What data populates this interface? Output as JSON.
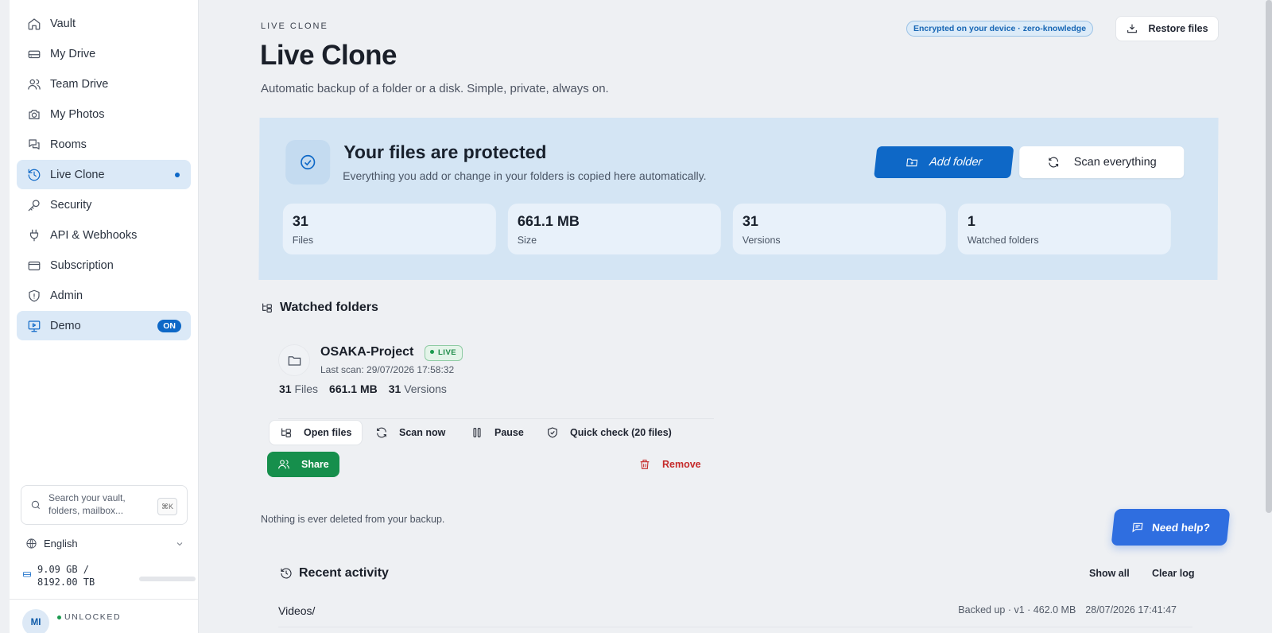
{
  "sidebar": {
    "items": [
      {
        "label": "Vault",
        "icon": "home-icon"
      },
      {
        "label": "My Drive",
        "icon": "drive-icon"
      },
      {
        "label": "Team Drive",
        "icon": "users-icon"
      },
      {
        "label": "My Photos",
        "icon": "camera-icon"
      },
      {
        "label": "Rooms",
        "icon": "chat-icon"
      },
      {
        "label": "Live Clone",
        "icon": "history-icon"
      },
      {
        "label": "Security",
        "icon": "key-icon"
      },
      {
        "label": "API & Webhooks",
        "icon": "plug-icon"
      },
      {
        "label": "Subscription",
        "icon": "card-icon"
      },
      {
        "label": "Admin",
        "icon": "shield-icon"
      },
      {
        "label": "Demo",
        "icon": "monitor-play-icon",
        "badge": "ON"
      }
    ],
    "search": {
      "placeholder_line1": "Search your vault,",
      "placeholder_line2": "folders, mailbox...",
      "shortcut": "⌘K"
    },
    "language": "English",
    "storage": {
      "line1": "9.09 GB /",
      "line2": "8192.00 TB",
      "used_fraction": 0.0
    },
    "avatar_initials": "MI",
    "status": "UNLOCKED"
  },
  "header": {
    "eyebrow": "LIVE CLONE",
    "title": "Live Clone",
    "subtitle": "Automatic backup of a folder or a disk. Simple, private, always on.",
    "encryption_badge": "Encrypted on your device · zero-knowledge",
    "restore_label": "Restore files"
  },
  "hero": {
    "title": "Your files are protected",
    "subtitle": "Everything you add or change in your folders is copied here automatically.",
    "add_folder_label": "Add folder",
    "scan_everything_label": "Scan everything",
    "stats": [
      {
        "value": "31",
        "label": "Files"
      },
      {
        "value": "661.1 MB",
        "label": "Size"
      },
      {
        "value": "31",
        "label": "Versions"
      },
      {
        "value": "1",
        "label": "Watched folders"
      }
    ]
  },
  "watched": {
    "heading": "Watched folders",
    "folder": {
      "name": "OSAKA-Project",
      "badge": "LIVE",
      "last_scan": "Last scan: 29/07/2026 17:58:32",
      "files_count": "31",
      "files_label": "Files",
      "size": "661.1 MB",
      "versions_count": "31",
      "versions_label": "Versions"
    },
    "actions": {
      "open": "Open files",
      "scan": "Scan now",
      "pause": "Pause",
      "check": "Quick check (20 files)",
      "share": "Share",
      "remove": "Remove"
    },
    "note": "Nothing is ever deleted from your backup."
  },
  "help_label": "Need help?",
  "activity": {
    "heading": "Recent activity",
    "show_all": "Show all",
    "clear_log": "Clear log",
    "rows": [
      {
        "name": "Videos/",
        "meta": "Backed up · v1 · 462.0 MB",
        "time": "28/07/2026 17:41:47"
      }
    ]
  },
  "colors": {
    "accent": "#0e68c7",
    "success": "#168f4c",
    "danger": "#c52a2a",
    "hero_bg": "#d4e5f4"
  }
}
